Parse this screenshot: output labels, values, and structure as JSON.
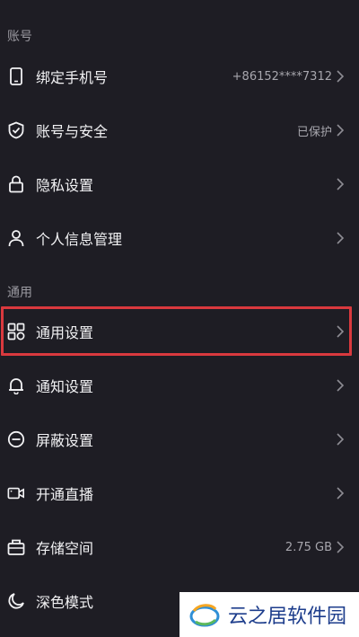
{
  "sections": {
    "account": "账号",
    "general": "通用"
  },
  "rows": [
    {
      "label": "绑定手机号",
      "value": "+86152****7312",
      "icon": "phone-icon"
    },
    {
      "label": "账号与安全",
      "value": "已保护",
      "icon": "shield-icon"
    },
    {
      "label": "隐私设置",
      "value": "",
      "icon": "lock-icon"
    },
    {
      "label": "个人信息管理",
      "value": "",
      "icon": "person-icon"
    },
    {
      "label": "通用设置",
      "value": "",
      "icon": "grid-icon"
    },
    {
      "label": "通知设置",
      "value": "",
      "icon": "bell-icon"
    },
    {
      "label": "屏蔽设置",
      "value": "",
      "icon": "block-icon"
    },
    {
      "label": "开通直播",
      "value": "",
      "icon": "camera-icon"
    },
    {
      "label": "存储空间",
      "value": "2.75 GB",
      "icon": "storage-icon"
    },
    {
      "label": "深色模式",
      "value": "",
      "icon": "moon-icon"
    }
  ],
  "watermark": {
    "text": "云之居软件园"
  },
  "colors": {
    "background": "#1e1d24",
    "highlight": "#d9393e",
    "watermark_text": "#1d3d8c"
  }
}
